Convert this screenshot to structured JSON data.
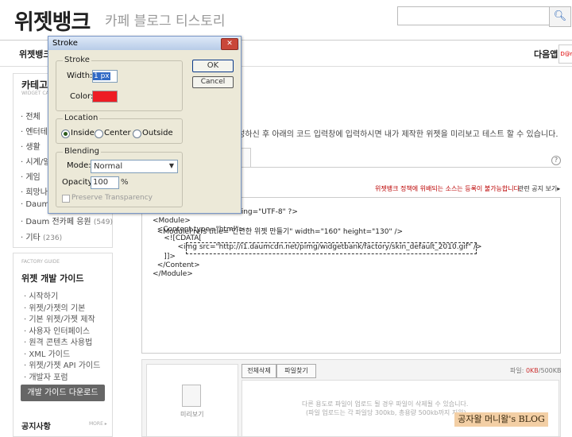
{
  "header": {
    "logo": "위젯뱅크",
    "subtabs": "카페  블로그  티스토리",
    "search_icon": "search-icon"
  },
  "nav": {
    "widgetbank_label": "위젯뱅크",
    "daum_app": "다음앱",
    "daum_badge": "D@m"
  },
  "category": {
    "title": "카테고리",
    "subtitle": "WIDGET CATE",
    "items": [
      {
        "label": "· 전체",
        "count": ""
      },
      {
        "label": "· 엔터테인",
        "count": ""
      },
      {
        "label": "· 생활",
        "count": ""
      },
      {
        "label": "· 시계/일",
        "count": ""
      },
      {
        "label": "· 게임",
        "count": ""
      },
      {
        "label": "· 희망나",
        "count": ""
      },
      {
        "label": "· Daum",
        "count": ""
      },
      {
        "label": "· Daum 전카페 응원",
        "count": "(549)"
      },
      {
        "label": "· 기타",
        "count": "(236)"
      }
    ]
  },
  "guide": {
    "subtitle": "FACTORY GUIDE",
    "title": "위젯 개발 가이드",
    "items": [
      "· 시작하기",
      "· 위젯/가젯의 기본",
      "· 기본 위젯/가젯 제작",
      "· 사용자 인터페이스",
      "· 원격 콘텐츠 사용법",
      "· XML 가이드",
      "· 위젯/가젯 API 가이드",
      "· 개발자 포럼"
    ],
    "download_button": "개발 가이드 다운로드",
    "notice": "공지사항",
    "notice_more": "MORE ▸"
  },
  "main": {
    "description": "작성하신 후 아래의 코드 입력창에 입력하시면 내가 제작한 위젯을 미리보고 테스트 할 수 있습니다.",
    "help": "?",
    "warning": "위젯뱅크 정책에 위배되는 소스는 등록이 불가능합니다.",
    "warning_link": "관련 공지 보기▸",
    "code_lines": [
      "ding=\"UTF-8\" ?>",
      "<Module>",
      "  <ModulePrefs title=\"간단한 위젯 만들기\" width=\"160\" height=\"130\" />",
      "  <Content type=\"html\">",
      "     <![CDATA[",
      "           <img src=\"http://i1.daumcdn.net/pimg/widgetbank/factory/skin_default_2010.gif\" />",
      "     ]]>",
      "  </Content>",
      "</Module>"
    ]
  },
  "bottom": {
    "preview_label": "미리보기",
    "delete_all": "전체삭제",
    "add_file": "파일찾기",
    "file_label": "파일:",
    "file_value": "0KB",
    "file_total": "/500KB",
    "drop_line1": "다른 용도로 파일이 업로드 될 경우 파일이 삭제될 수 있습니다.",
    "drop_line2": "(파일 업로드는 각 파일당 300kb, 총용량 500kb까지 지원)",
    "watermark": "공자왈 머니왈's BLOG"
  },
  "dialog": {
    "title": "Stroke",
    "close": "✕",
    "stroke_group": "Stroke",
    "width_label": "Width:",
    "width_value": "1 px",
    "color_label": "Color:",
    "color_value": "#ee1c24",
    "location_group": "Location",
    "location_options": [
      "Inside",
      "Center",
      "Outside"
    ],
    "location_selected": "Inside",
    "blending_group": "Blending",
    "mode_label": "Mode:",
    "mode_value": "Normal",
    "opacity_label": "Opacity:",
    "opacity_value": "100",
    "opacity_unit": "%",
    "preserve_label": "Preserve Transparency",
    "ok": "OK",
    "cancel": "Cancel"
  }
}
